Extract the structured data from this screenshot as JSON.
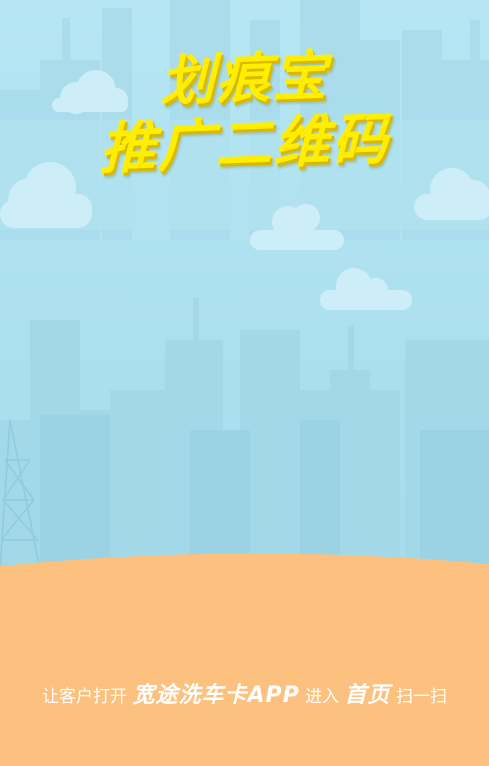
{
  "title": {
    "line1": "划痕宝",
    "line2": "推广二维码"
  },
  "instruction": {
    "prefix": "让客户打开",
    "app_name": "宽途洗车卡APP",
    "middle": "进入",
    "target": "首页",
    "suffix": "扫一扫"
  },
  "colors": {
    "sky": "#b3e3f1",
    "buildings": "#a0d6e6",
    "ground": "#fcc07f",
    "title": "#ffee00",
    "text": "#ffffff"
  }
}
